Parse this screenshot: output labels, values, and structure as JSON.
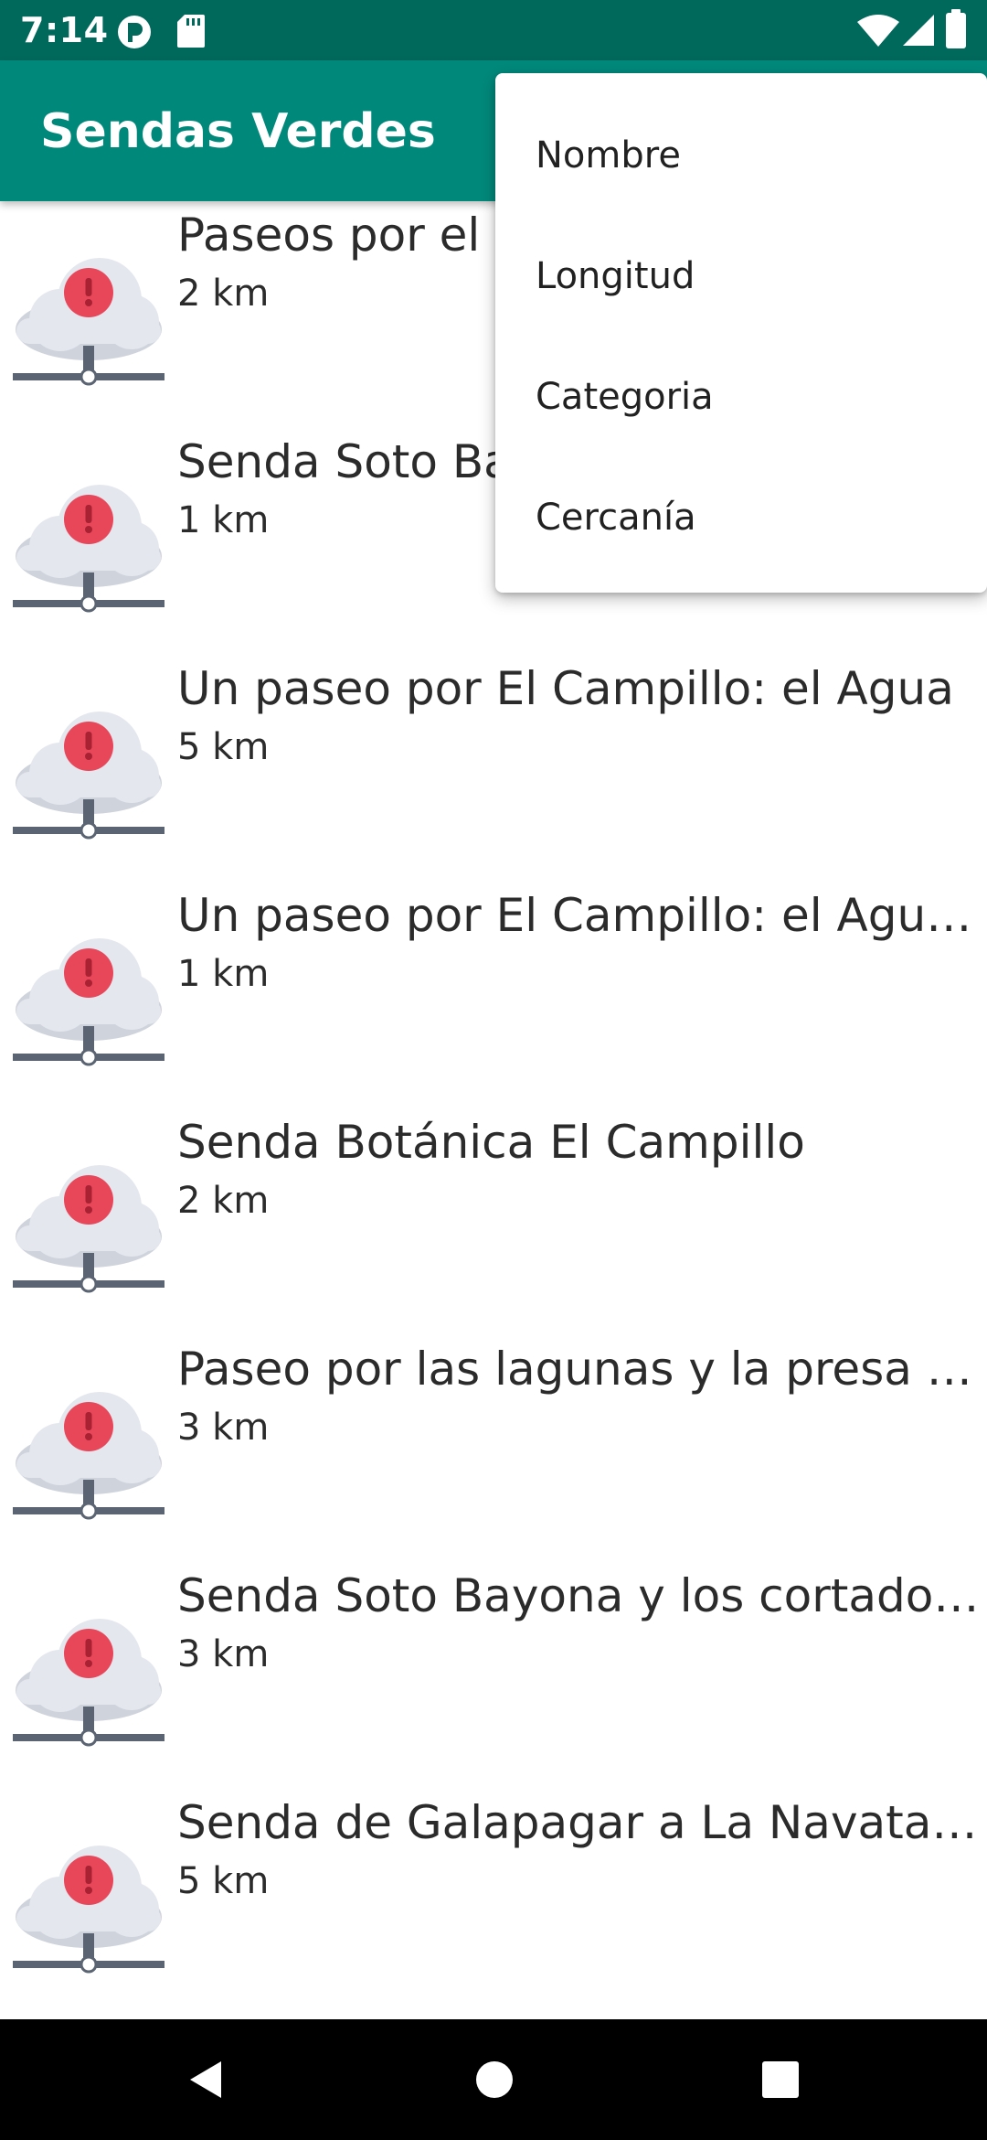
{
  "status_bar": {
    "time": "7:14",
    "icons": [
      "data-saver-icon",
      "sd-card-icon",
      "wifi-icon",
      "signal-icon",
      "battery-icon"
    ]
  },
  "app_bar": {
    "title": "Sendas Verdes",
    "background": "#00897b",
    "status_background": "#00695c"
  },
  "menu": {
    "items": [
      {
        "label": "Nombre"
      },
      {
        "label": "Longitud"
      },
      {
        "label": "Categoria"
      },
      {
        "label": "Cercanía"
      }
    ]
  },
  "trails": [
    {
      "title": "Paseos por el",
      "length": "2 km",
      "icon": "cloud-error-icon"
    },
    {
      "title": "Senda Soto Ba",
      "length": "1 km",
      "icon": "cloud-error-icon"
    },
    {
      "title": "Un paseo por El Campillo: el Agua",
      "length": "5 km",
      "icon": "cloud-error-icon"
    },
    {
      "title": "Un paseo por El Campillo: el Agua....",
      "length": "1 km",
      "icon": "cloud-error-icon"
    },
    {
      "title": "Senda Botánica El Campillo",
      "length": "2 km",
      "icon": "cloud-error-icon"
    },
    {
      "title": "Paseo por las lagunas y la presa d...",
      "length": "3 km",
      "icon": "cloud-error-icon"
    },
    {
      "title": "Senda Soto Bayona y los cortados...",
      "length": "3 km",
      "icon": "cloud-error-icon"
    },
    {
      "title": "Senda de Galapagar a La Navata -...",
      "length": "5 km",
      "icon": "cloud-error-icon"
    }
  ],
  "nav_bar": {
    "buttons": [
      "back-icon",
      "home-icon",
      "recents-icon"
    ]
  }
}
